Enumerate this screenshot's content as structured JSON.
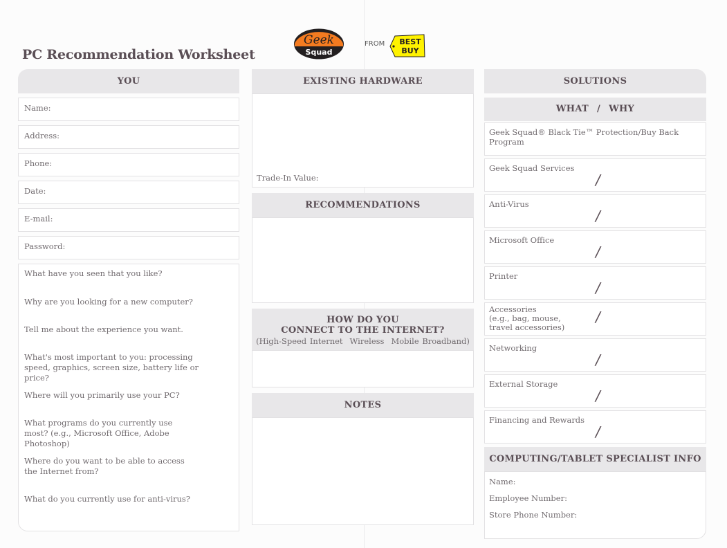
{
  "title": "PC Recommendation Worksheet",
  "logos": {
    "geek_squad": {
      "line1": "Geek",
      "line2": "Squad"
    },
    "from": "FROM",
    "best_buy": {
      "line1": "BEST",
      "line2": "BUY"
    }
  },
  "colors": {
    "header_bg": "#e8e7e9",
    "heading_text": "#5a4e55",
    "geek_orange": "#f47b20",
    "best_buy_yellow": "#fff200"
  },
  "you": {
    "header": "YOU",
    "fields": [
      "Name:",
      "Address:",
      "Phone:",
      "Date:",
      "E-mail:",
      "Password:"
    ],
    "questions": [
      "What have you seen that you like?",
      "Why are you looking for a new computer?",
      "Tell me about the experience you want.",
      "What's most important to you: processing speed, graphics, screen size, battery life or price?",
      "Where will you primarily use your PC?",
      "What programs do you currently use most? (e.g., Microsoft Office, Adobe Photoshop)",
      "Where do you want to be able to access the Internet from?",
      "What do you currently use for anti-virus?"
    ]
  },
  "existing_hardware": {
    "header": "EXISTING HARDWARE",
    "trade_in_label": "Trade-In Value:"
  },
  "recommendations": {
    "header": "RECOMMENDATIONS"
  },
  "internet": {
    "header_line1": "HOW DO YOU",
    "header_line2": "CONNECT TO THE INTERNET?",
    "options": [
      "(High-Speed Internet",
      "Wireless",
      "Mobile Broadband)"
    ]
  },
  "notes": {
    "header": "NOTES"
  },
  "solutions": {
    "header": "SOLUTIONS",
    "what": "WHAT",
    "slash": "/",
    "why": "WHY",
    "items": [
      "Geek Squad® Black Tie™ Protection/Buy Back Program",
      "Geek Squad Services",
      "Anti-Virus",
      "Microsoft Office",
      "Printer",
      "Accessories (e.g., bag, mouse, travel accessories)",
      "Networking",
      "External Storage",
      "Financing and Rewards"
    ],
    "accessories_lines": [
      "Accessories",
      "(e.g., bag, mouse,",
      "travel accessories)"
    ]
  },
  "specialist": {
    "header": "COMPUTING/TABLET SPECIALIST INFO",
    "fields": [
      "Name:",
      "Employee Number:",
      "Store Phone Number:"
    ]
  }
}
